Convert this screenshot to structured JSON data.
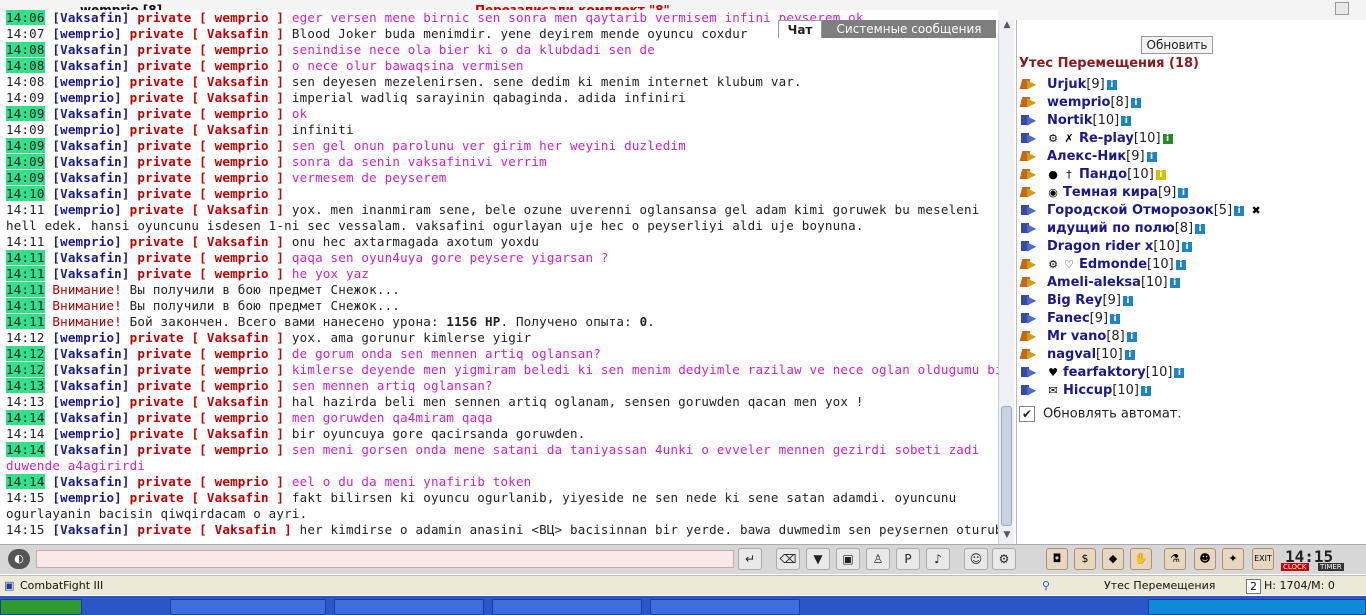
{
  "window": {
    "user": "wemprio [8]",
    "title": "Перезаписали комплект \"8\"",
    "close": "×"
  },
  "chat_tabs": {
    "chat": "Чат",
    "system": "Системные сообщения"
  },
  "messages": [
    {
      "time": "14:06",
      "hl": true,
      "kind": "p",
      "from": "Vaksafin",
      "to": "wemprio",
      "text": "eger versen mene birnic sen sonra men qaytarib vermisem infini peyserem ok"
    },
    {
      "time": "14:07",
      "hl": false,
      "kind": "p",
      "from": "wemprio",
      "to": "Vaksafin",
      "text": "Blood Joker buda menimdir. yene deyirem mende oyuncu coxdur"
    },
    {
      "time": "14:08",
      "hl": true,
      "kind": "p",
      "from": "Vaksafin",
      "to": "wemprio",
      "text": "senindise nece ola bier ki o da klubdadi sen de"
    },
    {
      "time": "14:08",
      "hl": true,
      "kind": "p",
      "from": "Vaksafin",
      "to": "wemprio",
      "text": "o nece olur bawaqsina vermisen"
    },
    {
      "time": "14:08",
      "hl": false,
      "kind": "p",
      "from": "wemprio",
      "to": "Vaksafin",
      "text": "sen deyesen mezelenirsen. sene dedim ki menim internet klubum var."
    },
    {
      "time": "14:09",
      "hl": false,
      "kind": "p",
      "from": "wemprio",
      "to": "Vaksafin",
      "text": "imperial wadliq sarayinin qabaginda. adida infiniri"
    },
    {
      "time": "14:09",
      "hl": true,
      "kind": "p",
      "from": "Vaksafin",
      "to": "wemprio",
      "text": "ok"
    },
    {
      "time": "14:09",
      "hl": false,
      "kind": "p",
      "from": "wemprio",
      "to": "Vaksafin",
      "text": "infiniti"
    },
    {
      "time": "14:09",
      "hl": true,
      "kind": "p",
      "from": "Vaksafin",
      "to": "wemprio",
      "text": "sen gel onun parolunu ver girim her weyini duzledim"
    },
    {
      "time": "14:09",
      "hl": true,
      "kind": "p",
      "from": "Vaksafin",
      "to": "wemprio",
      "text": "sonra da senin vaksafinivi verrim"
    },
    {
      "time": "14:09",
      "hl": true,
      "kind": "p",
      "from": "Vaksafin",
      "to": "wemprio",
      "text": "vermesem de peyserem"
    },
    {
      "time": "14:10",
      "hl": true,
      "kind": "p",
      "from": "Vaksafin",
      "to": "wemprio",
      "text": ""
    },
    {
      "time": "14:11",
      "hl": false,
      "kind": "p",
      "wrap": true,
      "from": "wemprio",
      "to": "Vaksafin",
      "text": "yox. men inanmiram sene, bele ozune uverenni oglansansa gel adam kimi goruwek bu meseleni hell edek. hansi oyuncunu isdesen 1-ni sec vessalam. vaksafini ogurlayan uje hec o peyserliyi aldi uje boynuna."
    },
    {
      "time": "14:11",
      "hl": false,
      "kind": "p",
      "from": "wemprio",
      "to": "Vaksafin",
      "text": "onu hec axtarmagada axotum yoxdu"
    },
    {
      "time": "14:11",
      "hl": true,
      "kind": "p",
      "from": "Vaksafin",
      "to": "wemprio",
      "text": "qaqa sen oyun4uya gore peysere yigarsan ?"
    },
    {
      "time": "14:11",
      "hl": true,
      "kind": "p",
      "from": "Vaksafin",
      "to": "wemprio",
      "text": "he yox yaz"
    },
    {
      "time": "14:11",
      "hl": true,
      "kind": "s",
      "warn": "Внимание!",
      "text": "Вы получили в бою предмет Снежок..."
    },
    {
      "time": "14:11",
      "hl": true,
      "kind": "s",
      "warn": "Внимание!",
      "text": "Вы получили в бою предмет Снежок..."
    },
    {
      "time": "14:11",
      "hl": true,
      "kind": "b",
      "warn": "Внимание!",
      "text": "Бой закончен. Всего вами нанесено урона:",
      "dmg": "1156 HP",
      "mid": ". Получено опыта:",
      "exp": "0",
      "end": "."
    },
    {
      "time": "14:12",
      "hl": false,
      "kind": "p",
      "from": "wemprio",
      "to": "Vaksafin",
      "text": "yox. ama gorunur kimlerse yigir"
    },
    {
      "time": "14:12",
      "hl": true,
      "kind": "p",
      "from": "Vaksafin",
      "to": "wemprio",
      "text": "de gorum onda sen mennen artiq oglansan?"
    },
    {
      "time": "14:12",
      "hl": true,
      "kind": "p",
      "from": "Vaksafin",
      "to": "wemprio",
      "text": "kimlerse deyende men yigmiram beledi ki sen menim dedyimle razilaw ve nece oglan oldugumu bil"
    },
    {
      "time": "14:13",
      "hl": true,
      "kind": "p",
      "from": "Vaksafin",
      "to": "wemprio",
      "text": "sen mennen artiq oglansan?"
    },
    {
      "time": "14:13",
      "hl": false,
      "kind": "p",
      "from": "wemprio",
      "to": "Vaksafin",
      "text": "hal hazirda beli men sennen artiq oglanam, sensen goruwden qacan men yox !"
    },
    {
      "time": "14:14",
      "hl": true,
      "kind": "p",
      "from": "Vaksafin",
      "to": "wemprio",
      "text": "men goruwden qa4miram qaqa"
    },
    {
      "time": "14:14",
      "hl": false,
      "kind": "p",
      "from": "wemprio",
      "to": "Vaksafin",
      "text": "bir oyuncuya gore qacirsanda goruwden."
    },
    {
      "time": "14:14",
      "hl": true,
      "kind": "p",
      "wrap": true,
      "from": "Vaksafin",
      "to": "wemprio",
      "text": "sen meni gorsen onda mene satani da taniyassan 4unki o evveler mennen gezirdi sobeti zadi duwende a4agirirdi"
    },
    {
      "time": "14:14",
      "hl": true,
      "kind": "p",
      "from": "Vaksafin",
      "to": "wemprio",
      "text": "eel o du da meni ynafirib token"
    },
    {
      "time": "14:15",
      "hl": false,
      "kind": "p",
      "wrap": true,
      "from": "wemprio",
      "to": "Vaksafin",
      "text": "fakt bilirsen ki oyuncu ogurlanib, yiyeside ne sen nede ki sene satan adamdi. oyuncunu ogurlayanin bacisin qiwqirdacam o ayri."
    },
    {
      "time": "14:15",
      "hl": false,
      "kind": "p",
      "from": "Vaksafin",
      "to": "Vaksafin",
      "text": "her kimdirse o adamin anasini <ВЦ> bacisinnan bir yerde. bawa duwmedim sen peysernen oturub durursan ?"
    }
  ],
  "sidebar": {
    "refresh": "Обновить",
    "room": "Утес Перемещения (18)",
    "auto_label": "Обновлять автомат.",
    "auto_check": "✔",
    "players": [
      {
        "name": "Urjuk",
        "lvl": "[9]",
        "arrow": "a1",
        "ex": []
      },
      {
        "name": "wemprio",
        "lvl": "[8]",
        "arrow": "a1",
        "ex": []
      },
      {
        "name": "Nortik",
        "lvl": "[10]",
        "arrow": "a2",
        "ex": []
      },
      {
        "name": "Re-play",
        "lvl": "[10]",
        "arrow": "a2",
        "ex": [
          "⚙",
          "✗"
        ],
        "infc": "gr"
      },
      {
        "name": "Алекс-Ник",
        "lvl": "[9]",
        "arrow": "a1",
        "ex": []
      },
      {
        "name": "Пандо",
        "lvl": "[10]",
        "arrow": "a1",
        "ex": [
          "●",
          "†"
        ],
        "infc": "y"
      },
      {
        "name": "Темная кира",
        "lvl": "[9]",
        "arrow": "a1",
        "ex": [
          "◉"
        ]
      },
      {
        "name": "Городской Отморозок",
        "lvl": "[5]",
        "arrow": "a2",
        "ex": [],
        "x": "✖"
      },
      {
        "name": "идущий по полю",
        "lvl": "[8]",
        "arrow": "a2",
        "ex": []
      },
      {
        "name": "Dragon rider x",
        "lvl": "[10]",
        "arrow": "a2",
        "ex": []
      },
      {
        "name": "Edmonde",
        "lvl": "[10]",
        "arrow": "a1",
        "ex": [
          "⚙",
          "♡"
        ]
      },
      {
        "name": "Ameli-aleksa",
        "lvl": "[10]",
        "arrow": "a1",
        "ex": []
      },
      {
        "name": "Big Rey",
        "lvl": "[9]",
        "arrow": "a2",
        "ex": []
      },
      {
        "name": "Fanec",
        "lvl": "[9]",
        "arrow": "a2",
        "ex": []
      },
      {
        "name": "Mr vano",
        "lvl": "[8]",
        "arrow": "a1",
        "ex": []
      },
      {
        "name": "nagval",
        "lvl": "[10]",
        "arrow": "a1",
        "ex": []
      },
      {
        "name": "fearfaktory",
        "lvl": "[10]",
        "arrow": "a2",
        "ex": [
          "♥"
        ]
      },
      {
        "name": "Hiccup",
        "lvl": "[10]",
        "arrow": "a2",
        "ex": [
          "✉"
        ]
      }
    ]
  },
  "toolbar": {
    "clock": "14:15",
    "clock_label": "CLOCK",
    "timer_label": "TIMER",
    "exit": "EXIT"
  },
  "status": {
    "app": "CombatFight III",
    "location": "Утес Перемещения",
    "level": "2",
    "hp": "H: 1704/M: 0"
  }
}
